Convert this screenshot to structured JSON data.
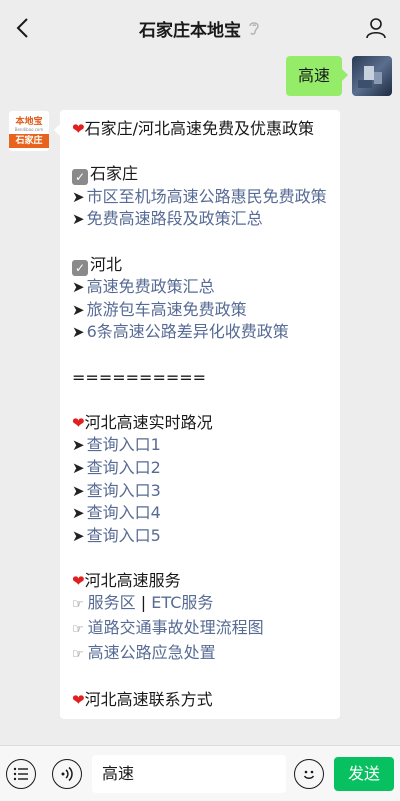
{
  "header": {
    "title": "石家庄本地宝"
  },
  "user_message": {
    "text": "高速"
  },
  "bot_avatar": {
    "logo_text": "本地宝",
    "logo_sub": "Bendibao.com",
    "city": "石家庄"
  },
  "bot_message": {
    "title": "石家庄/河北高速免费及优惠政策",
    "section1": {
      "heading": "石家庄",
      "links": [
        "市区至机场高速公路惠民免费政策",
        "免费高速路段及政策汇总"
      ]
    },
    "section2": {
      "heading": "河北",
      "links": [
        "高速免费政策汇总",
        "旅游包车高速免费政策",
        "6条高速公路差异化收费政策"
      ]
    },
    "separator": "==========",
    "section3": {
      "heading": "河北高速实时路况",
      "links": [
        "查询入口1",
        "查询入口2",
        "查询入口3",
        "查询入口4",
        "查询入口5"
      ]
    },
    "section4": {
      "heading": "河北高速服务",
      "service_a": "服务区",
      "pipe": "|",
      "service_b": "ETC服务",
      "links": [
        "道路交通事故处理流程图",
        "高速公路应急处置"
      ]
    },
    "section5": {
      "heading": "河北高速联系方式"
    }
  },
  "input_bar": {
    "value": "高速",
    "send_label": "发送"
  },
  "colors": {
    "link": "#576b95",
    "user_bubble": "#95ec69",
    "send": "#07c160"
  }
}
